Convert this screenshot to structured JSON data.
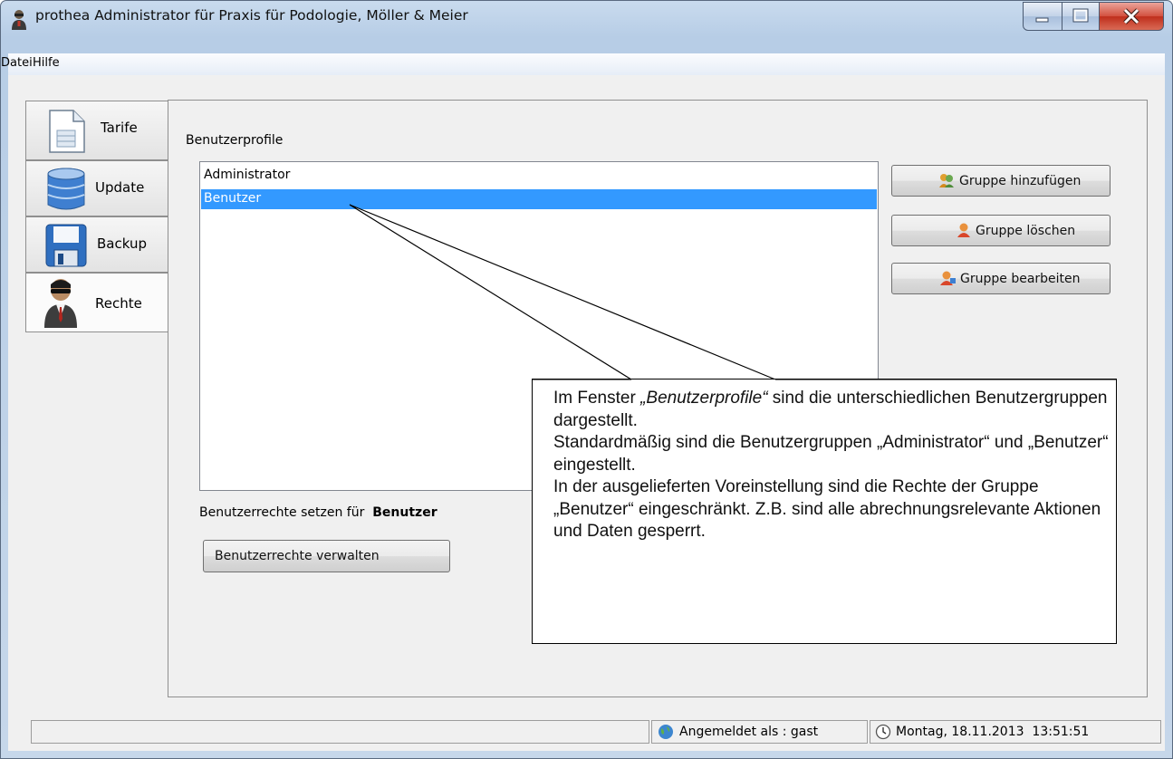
{
  "window": {
    "title": "prothea Administrator für Praxis für Podologie, Möller & Meier"
  },
  "menu": {
    "items": [
      "Datei",
      "Hilfe"
    ]
  },
  "tabs": [
    {
      "label": "Tarife",
      "icon": "document-icon"
    },
    {
      "label": "Update",
      "icon": "database-icon"
    },
    {
      "label": "Backup",
      "icon": "floppy-disk-icon"
    },
    {
      "label": "Rechte",
      "icon": "user-sunglasses-icon"
    }
  ],
  "active_tab": "Rechte",
  "rights": {
    "profiles_label": "Benutzerprofile",
    "profiles": [
      "Administrator",
      "Benutzer"
    ],
    "selected_profile": "Benutzer",
    "set_rights_prefix": "Benutzerrechte setzen für",
    "set_rights_target": "Benutzer",
    "manage_button": "Benutzerrechte verwalten",
    "buttons": {
      "add": "Gruppe hinzufügen",
      "delete": "Gruppe löschen",
      "edit": "Gruppe bearbeiten"
    }
  },
  "callout": {
    "intro_prefix": "Im Fenster ",
    "intro_emph": "„Benutzerprofile“",
    "intro_suffix": " sind die unterschiedlichen Benutzergruppen dargestellt.",
    "line2": "Standardmäßig sind die Benutzergruppen „Administrator“ und „Benutzer“ eingestellt.",
    "line3": "In der ausgelieferten Voreinstellung sind die Rechte der Gruppe „Benutzer“ eingeschränkt. Z.B. sind alle abrechnungsrelevante Aktionen und Daten gesperrt."
  },
  "status": {
    "logged_in": "Angemeldet als : gast",
    "datetime": "Montag, 18.11.2013  13:51:51"
  },
  "colors": {
    "selection": "#3399ff",
    "close_button": "#c9331f",
    "titlebar": "#b9cfe8"
  }
}
